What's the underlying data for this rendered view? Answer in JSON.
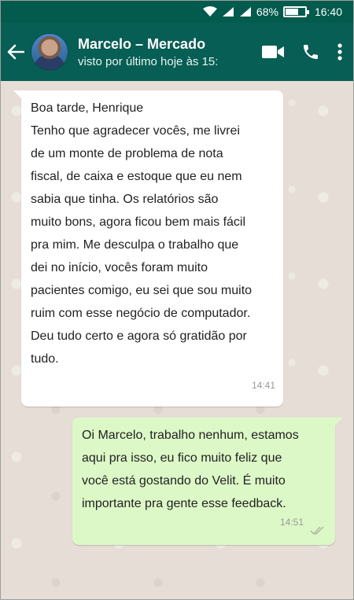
{
  "status_bar": {
    "battery": "68%",
    "battery_level": 0.68,
    "time": "16:40",
    "icons": [
      "wifi-icon",
      "signal-icon",
      "signal-icon",
      "battery-icon"
    ]
  },
  "header": {
    "contact_name": "Marcelo – Mercado",
    "contact_status": "visto por último hoje às 15:",
    "actions": [
      "video-call-icon",
      "phone-icon",
      "more-options-icon"
    ],
    "colors": {
      "status_bar": "#035b4e",
      "app_bar": "#075e54"
    }
  },
  "messages": [
    {
      "direction": "incoming",
      "lines": [
        "Boa tarde, Henrique",
        "Tenho que agradecer vocês, me livrei",
        "de um monte de problema de nota",
        "fiscal, de caixa e estoque que eu nem",
        "sabia que tinha. Os relatórios são",
        "muito bons, agora ficou bem mais fácil",
        "pra mim. Me desculpa o trabalho que",
        "dei no início, vocês foram muito",
        "pacientes comigo, eu sei que sou muito",
        "ruim com esse negócio de computador.",
        "Deu tudo certo e agora só gratidão por",
        "tudo."
      ],
      "time": "14:41",
      "color": "#ffffff"
    },
    {
      "direction": "outgoing",
      "lines": [
        "Oi Marcelo, trabalho nenhum, estamos",
        "aqui pra isso, eu fico muito feliz que",
        "você está gostando do Velit. É muito",
        "importante pra gente esse feedback."
      ],
      "time": "14:51",
      "status": "delivered",
      "color": "#dcf8c6"
    }
  ]
}
